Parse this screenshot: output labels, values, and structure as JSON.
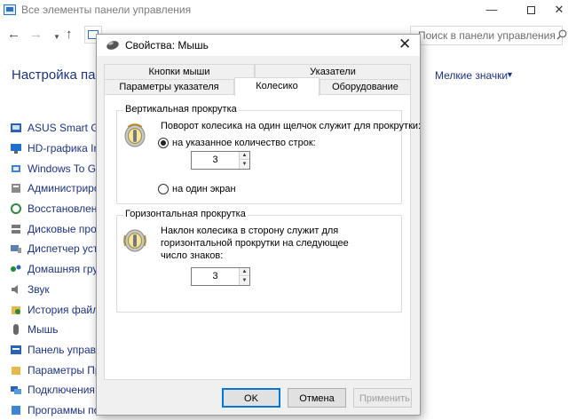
{
  "control_panel": {
    "window_title": "Все элементы панели управления",
    "search_placeholder": "Поиск в панели управления",
    "heading": "Настройка пар",
    "view_label": "Мелкие значки",
    "items": [
      {
        "label": "ASUS Smart Gest",
        "icon": "touchpad-icon"
      },
      {
        "label": "HD-графика Inte",
        "icon": "display-icon"
      },
      {
        "label": "Windows To Go",
        "icon": "usb-drive-icon"
      },
      {
        "label": "Администриров",
        "icon": "admin-tools-icon"
      },
      {
        "label": "Восстановлени",
        "icon": "recovery-icon"
      },
      {
        "label": "Дисковые прост",
        "icon": "storage-icon"
      },
      {
        "label": "Диспетчер устр",
        "icon": "device-manager-icon"
      },
      {
        "label": "Домашняя груп",
        "icon": "homegroup-icon"
      },
      {
        "label": "Звук",
        "icon": "speaker-icon"
      },
      {
        "label": "История файло",
        "icon": "file-history-icon"
      },
      {
        "label": "Мышь",
        "icon": "mouse-icon"
      },
      {
        "label": "Панель управле",
        "icon": "control-panel-icon"
      },
      {
        "label": "Параметры Про",
        "icon": "explorer-options-icon"
      },
      {
        "label": "Подключения к",
        "icon": "remote-connections-icon"
      },
      {
        "label": "Программы по",
        "icon": "default-programs-icon"
      }
    ]
  },
  "dialog": {
    "title": "Свойства: Мышь",
    "tabs_row1": [
      "Кнопки мыши",
      "Указатели"
    ],
    "tabs_row2": [
      "Параметры указателя",
      "Колесико",
      "Оборудование"
    ],
    "active_tab": "Колесико",
    "vertical": {
      "group_label": "Вертикальная прокрутка",
      "description": "Поворот колесика на один щелчок служит для прокрутки:",
      "option_lines": "на указанное количество строк:",
      "lines_value": "3",
      "option_screen": "на один экран",
      "selected": "lines"
    },
    "horizontal": {
      "group_label": "Горизонтальная прокрутка",
      "description_lines": [
        "Наклон колесика в сторону служит для",
        "горизонтальной прокрутки на следующее",
        "число знаков:"
      ],
      "chars_value": "3"
    },
    "buttons": {
      "ok": "OK",
      "cancel": "Отмена",
      "apply": "Применить"
    }
  }
}
